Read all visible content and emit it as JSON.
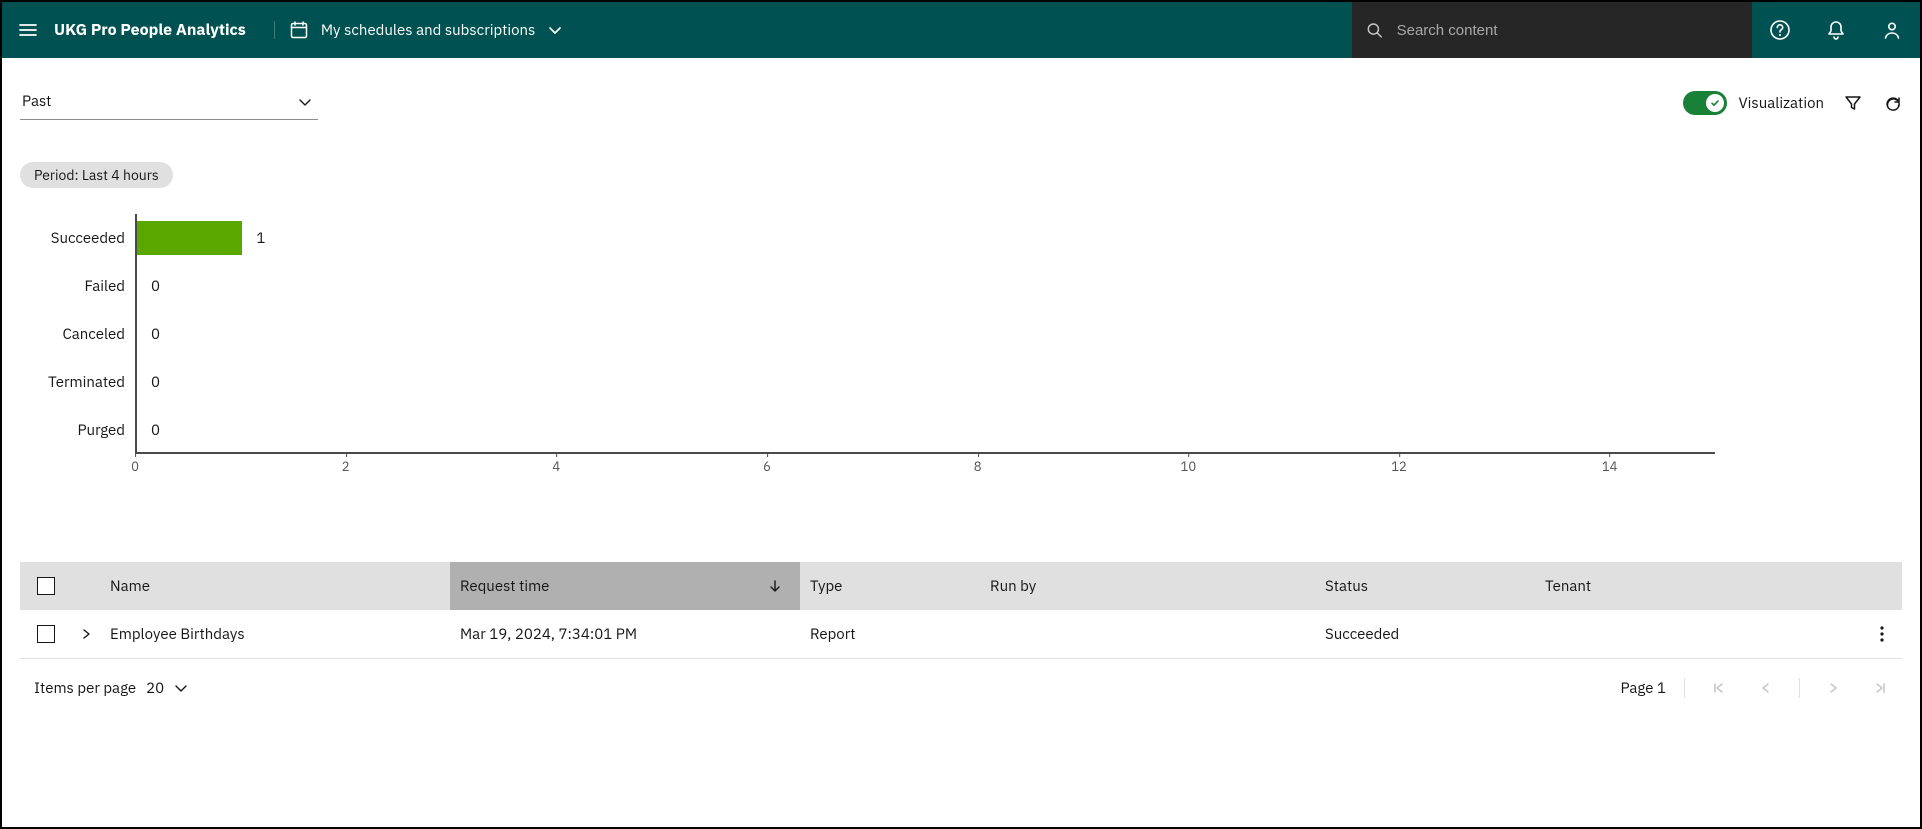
{
  "header": {
    "brand": "UKG Pro People Analytics",
    "crumb_label": "My schedules and subscriptions",
    "search_placeholder": "Search content"
  },
  "filter_select": {
    "value": "Past"
  },
  "toggle": {
    "visualization_label": "Visualization",
    "on": true
  },
  "chip": {
    "period_label": "Period: Last 4 hours"
  },
  "chart_data": {
    "type": "bar",
    "orientation": "horizontal",
    "categories": [
      "Succeeded",
      "Failed",
      "Canceled",
      "Terminated",
      "Purged"
    ],
    "values": [
      1,
      0,
      0,
      0,
      0
    ],
    "x_ticks": [
      0,
      2,
      4,
      6,
      8,
      10,
      12,
      14
    ],
    "xlim": [
      0,
      15
    ],
    "color": "#5aa700"
  },
  "table": {
    "columns": {
      "name": "Name",
      "request_time": "Request time",
      "type": "Type",
      "run_by": "Run by",
      "status": "Status",
      "tenant": "Tenant"
    },
    "rows": [
      {
        "name": "Employee Birthdays",
        "request_time": "Mar 19, 2024, 7:34:01 PM",
        "type": "Report",
        "run_by": "",
        "status": "Succeeded",
        "tenant": ""
      }
    ]
  },
  "pagination": {
    "items_per_page_label": "Items per page",
    "items_per_page_value": "20",
    "page_label": "Page 1"
  }
}
